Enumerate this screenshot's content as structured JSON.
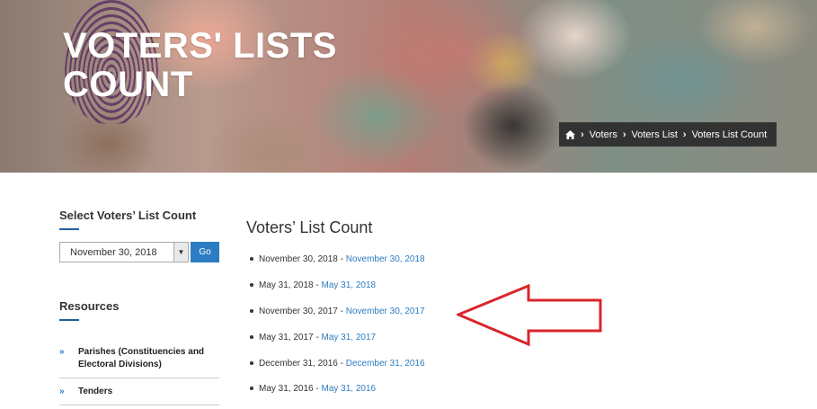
{
  "hero": {
    "title_line1": "VOTERS' LISTS",
    "title_line2": "COUNT"
  },
  "breadcrumb": {
    "home_icon": "home-icon",
    "items": [
      "Voters",
      "Voters List",
      "Voters List Count"
    ]
  },
  "sidebar": {
    "select_heading": "Select Voters’ List Count",
    "select_value": "November 30, 2018",
    "go_label": "Go",
    "resources_heading": "Resources",
    "resources": [
      "Parishes (Constituencies and Electoral Divisions)",
      "Tenders"
    ]
  },
  "main": {
    "title": "Voters’ List Count",
    "items": [
      {
        "date": "November 30, 2018",
        "link": "November 30, 2018"
      },
      {
        "date": "May 31, 2018",
        "link": "May 31, 2018"
      },
      {
        "date": "November 30, 2017",
        "link": "November 30, 2017"
      },
      {
        "date": "May 31, 2017",
        "link": "May 31, 2017"
      },
      {
        "date": "December 31, 2016",
        "link": "December 31, 2016"
      },
      {
        "date": "May 31, 2016",
        "link": "May 31, 2016"
      }
    ]
  },
  "colors": {
    "accent": "#2c7cc1",
    "annotation_arrow": "#d9252b"
  }
}
